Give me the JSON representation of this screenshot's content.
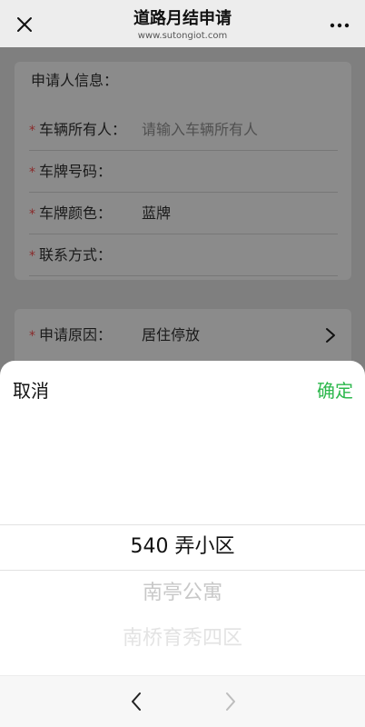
{
  "header": {
    "title": "道路月结申请",
    "subtitle": "www.sutongiot.com"
  },
  "form": {
    "section_title": "申请人信息：",
    "required_mark": "*",
    "rows": [
      {
        "label": "车辆所有人：",
        "value": "",
        "placeholder": "请输入车辆所有人"
      },
      {
        "label": "车牌号码：",
        "value": ""
      },
      {
        "label": "车牌颜色：",
        "value": "蓝牌"
      },
      {
        "label": "联系方式：",
        "value": ""
      }
    ],
    "reason": {
      "label": "申请原因：",
      "value": "居住停放"
    }
  },
  "picker": {
    "cancel_label": "取消",
    "confirm_label": "确定",
    "options": [
      "540 弄小区",
      "南亭公寓",
      "南桥育秀四区"
    ],
    "selected_index": 0
  },
  "colors": {
    "accent": "#2db84d",
    "required": "#8a2a2a"
  },
  "icons": [
    "close-icon",
    "more-icon",
    "chevron-right-icon",
    "nav-back-icon",
    "nav-forward-icon"
  ]
}
